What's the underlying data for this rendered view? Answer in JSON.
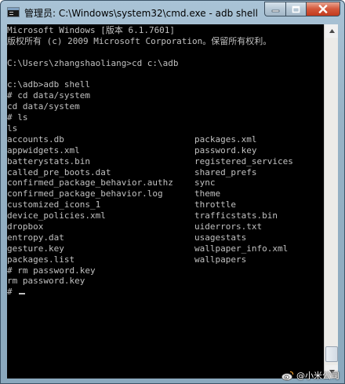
{
  "window": {
    "title": "管理员: C:\\Windows\\system32\\cmd.exe - adb  shell"
  },
  "icons": {
    "app": "console-window-icon",
    "minimize": "minimize-icon",
    "maximize": "maximize-icon",
    "close": "close-icon",
    "scroll_up": "arrow-up-icon",
    "scroll_down": "arrow-down-icon",
    "watermark": "weibo-logo-icon"
  },
  "colors": {
    "console_bg": "#000000",
    "console_text": "#c0c0c0",
    "close_button": "#c9452a"
  },
  "console": {
    "lines": [
      "Microsoft Windows [版本 6.1.7601]",
      "版权所有 (c) 2009 Microsoft Corporation。保留所有权利。",
      "",
      "C:\\Users\\zhangshaoliang>cd c:\\adb",
      "",
      "c:\\adb>adb shell",
      "# cd data/system",
      "cd data/system",
      "# ls",
      "ls"
    ],
    "listing": [
      [
        "accounts.db",
        "packages.xml"
      ],
      [
        "appwidgets.xml",
        "password.key"
      ],
      [
        "batterystats.bin",
        "registered_services"
      ],
      [
        "called_pre_boots.dat",
        "shared_prefs"
      ],
      [
        "confirmed_package_behavior.authz",
        "sync"
      ],
      [
        "confirmed_package_behavior.log",
        "theme"
      ],
      [
        "customized_icons_1",
        "throttle"
      ],
      [
        "device_policies.xml",
        "trafficstats.bin"
      ],
      [
        "dropbox",
        "uiderrors.txt"
      ],
      [
        "entropy.dat",
        "usagestats"
      ],
      [
        "gesture.key",
        "wallpaper_info.xml"
      ],
      [
        "packages.list",
        "wallpapers"
      ]
    ],
    "after": [
      "# rm password.key",
      "rm password.key",
      "# "
    ]
  },
  "watermark": {
    "text": "@小米公司"
  }
}
